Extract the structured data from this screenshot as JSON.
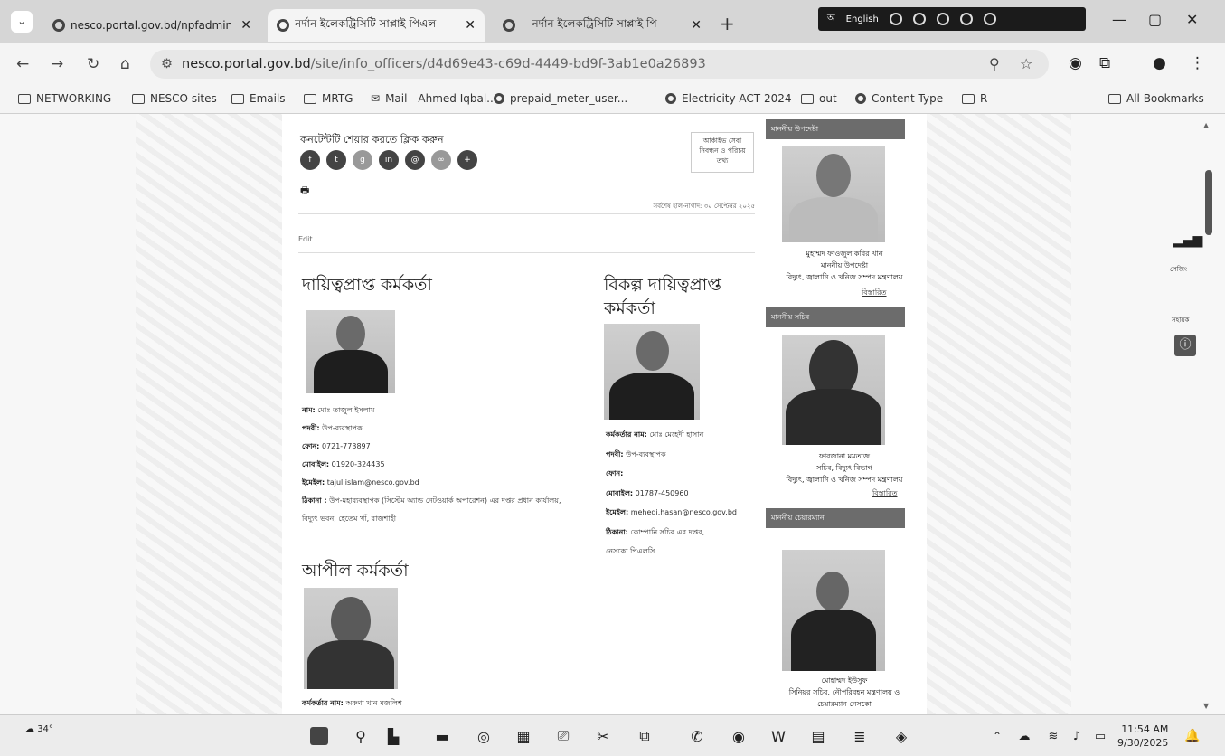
{
  "browser": {
    "tabs": [
      {
        "title": "nesco.portal.gov.bd/npfadmin/",
        "active": false
      },
      {
        "title": "নর্দান ইলেকট্রিসিটি সাপ্লাই পিএল",
        "active": true
      },
      {
        "title": "-- নর্দান ইলেকট্রিসিটি সাপ্লাই পি",
        "active": false
      }
    ],
    "lang_label": "English",
    "url_host": "nesco.portal.gov.bd",
    "url_path": "/site/info_officers/d4d69e43-c69d-4449-bd9f-3ab1e0a26893",
    "bookmarks": [
      {
        "label": "NETWORKING",
        "icon": "folder-icon"
      },
      {
        "label": "NESCO sites",
        "icon": "folder-icon"
      },
      {
        "label": "Emails",
        "icon": "folder-icon"
      },
      {
        "label": "MRTG",
        "icon": "folder-icon"
      },
      {
        "label": "Mail - Ahmed Iqbal...",
        "icon": "mail-icon"
      },
      {
        "label": "prepaid_meter_user...",
        "icon": "globe-icon"
      },
      {
        "label": "Electricity ACT 2024",
        "icon": "globe-icon"
      },
      {
        "label": "out",
        "icon": "folder-icon"
      },
      {
        "label": "Content Type",
        "icon": "globe-icon"
      },
      {
        "label": "R",
        "icon": "folder-icon"
      }
    ],
    "all_bookmarks": "All Bookmarks"
  },
  "page": {
    "share_title": "কনটেন্টটি শেয়ার করতে ক্লিক করুন",
    "logbox_text": "আর্কাইভ সেবা নিবন্ধন ও পরিচয় তথ্য",
    "updated": "সর্বশেষ হাল-নাগাদ: ৩০ সেপ্টেম্বর ২০২৫",
    "edit": "Edit",
    "officer_title": "দায়িত্বপ্রাপ্ত কর্মকর্তা",
    "officer_lines": [
      {
        "label": "নাম:",
        "value": "মোঃ তাজুল ইসলাম"
      },
      {
        "label": "পদবী:",
        "value": "উপ-ব্যবস্থাপক"
      },
      {
        "label": "ফোন:",
        "value": "0721-773897"
      },
      {
        "label": "মোবাইল:",
        "value": "01920-324435"
      },
      {
        "label": "ইমেইল:",
        "value": "tajul.islam@nesco.gov.bd"
      },
      {
        "label": "ঠিকানা :",
        "value": "উপ-মহাব্যবস্থাপক (সিস্টেম অ্যান্ড নেটওয়ার্ক অপারেশন) এর দপ্তর প্রধান কার্যালয়,"
      },
      {
        "label": "",
        "value": "বিদ্যুৎ ভবন, হেতেম খাঁ, রাজশাহী"
      }
    ],
    "alt_title": "বিকল্প দায়িত্বপ্রাপ্ত কর্মকর্তা",
    "alt_lines": [
      {
        "label": "কর্মকর্তার নাম:",
        "value": "মোঃ মেহেদী হাসান"
      },
      {
        "label": "পদবী:",
        "value": "উপ-ব্যবস্থাপক"
      },
      {
        "label": "ফোন:",
        "value": ""
      },
      {
        "label": "মোবাইল:",
        "value": "01787-450960"
      },
      {
        "label": "ইমেইল:",
        "value": "mehedi.hasan@nesco.gov.bd"
      },
      {
        "label": "ঠিকানা:",
        "value": "কোম্পানি সচিব এর দপ্তর,"
      },
      {
        "label": "",
        "value": "নেসকো পিএলসি"
      }
    ],
    "appeal_title": "আপীল কর্মকর্তা",
    "appeal_lines": [
      {
        "label": "কর্মকর্তার নাম:",
        "value": "অরুণা খান মজলিশ"
      }
    ]
  },
  "sidebar": {
    "blocks": [
      {
        "head": "মাননীয় উপদেষ্টা",
        "lines": [
          "মুহাম্মদ ফাওজুল কবির খান",
          "মাননীয় উপদেষ্টা",
          "বিদ্যুৎ, জ্বালানি ও খনিজ সম্পদ মন্ত্রণালয়"
        ],
        "more": "বিস্তারিত"
      },
      {
        "head": "মাননীয় সচিব",
        "lines": [
          "ফারজানা মমতাজ",
          "সচিব, বিদ্যুৎ বিভাগ",
          "বিদ্যুৎ, জ্বালানি ও খনিজ সম্পদ মন্ত্রণালয়"
        ],
        "more": "বিস্তারিত"
      },
      {
        "head": "মাননীয় চেয়ারম্যান",
        "lines": [
          "মোহাম্মদ ইউসুফ",
          "সিনিয়র সচিব, নৌপরিবহন মন্ত্রণালয় ও",
          "চেয়ারম্যান নেসকো"
        ],
        "more": ""
      }
    ]
  },
  "right_widgets": {
    "signal_label": "পেজিং",
    "access_label": "সহায়ক"
  },
  "taskbar": {
    "weather": "34°",
    "time": "11:54 AM",
    "date": "9/30/2025"
  }
}
